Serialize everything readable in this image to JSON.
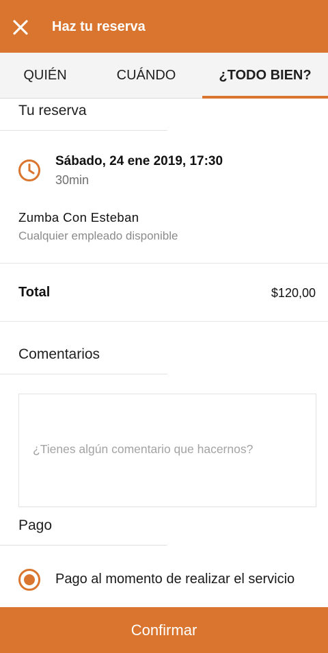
{
  "appbar": {
    "title": "Haz tu reserva",
    "close_icon": "close-icon"
  },
  "tabs": [
    {
      "label": "QUIÉN"
    },
    {
      "label": "CUÁNDO"
    },
    {
      "label": "¿TODO BIEN?",
      "active": true
    }
  ],
  "reservation": {
    "section_title": "Tu reserva",
    "date_time": "Sábado, 24 ene 2019, 17:30",
    "duration": "30min",
    "clock_icon": "clock-icon",
    "service_name": "Zumba Con Esteban",
    "staff": "Cualquier empleado disponible"
  },
  "total": {
    "label": "Total",
    "value": "$120,00"
  },
  "comments": {
    "section_title": "Comentarios",
    "placeholder": "¿Tienes algún comentario que hacernos?",
    "value": ""
  },
  "payment": {
    "section_title": "Pago",
    "options": [
      {
        "label": "Pago al momento de realizar el servicio",
        "selected": true
      }
    ]
  },
  "confirm_button": {
    "label": "Confirmar"
  },
  "colors": {
    "accent": "#D9752E",
    "divider": "#e2e2e2",
    "secondary_text": "#8a8a8a"
  }
}
